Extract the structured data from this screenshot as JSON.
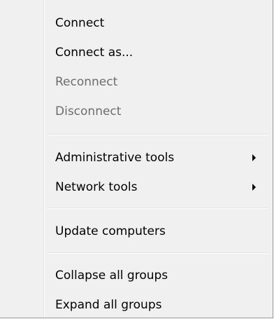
{
  "menu": {
    "items": [
      {
        "label": "Connect",
        "disabled": false,
        "has_submenu": false
      },
      {
        "label": "Connect as...",
        "disabled": false,
        "has_submenu": false
      },
      {
        "label": "Reconnect",
        "disabled": true,
        "has_submenu": false
      },
      {
        "label": "Disconnect",
        "disabled": true,
        "has_submenu": false
      },
      {
        "label": "Administrative tools",
        "disabled": false,
        "has_submenu": true
      },
      {
        "label": "Network tools",
        "disabled": false,
        "has_submenu": true
      },
      {
        "label": "Update computers",
        "disabled": false,
        "has_submenu": false
      },
      {
        "label": "Collapse all groups",
        "disabled": false,
        "has_submenu": false
      },
      {
        "label": "Expand all groups",
        "disabled": false,
        "has_submenu": false
      }
    ],
    "submenu_arrow_icon": "chevron-right-icon",
    "colors": {
      "background": "#f0f0f0",
      "text": "#000000",
      "disabled_text": "#6d6d6d",
      "separator": "#e2e3e3"
    }
  }
}
